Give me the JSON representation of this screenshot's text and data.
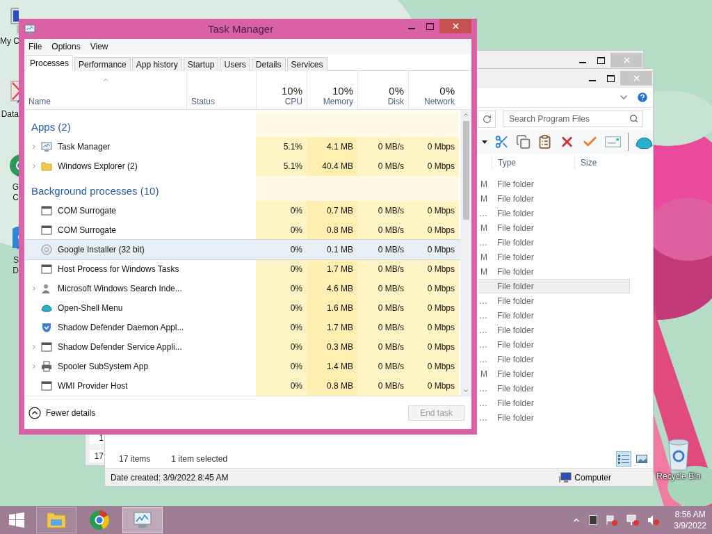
{
  "desktop_icons": [
    {
      "kind": "computer",
      "label": [
        "My C"
      ]
    },
    {
      "kind": "crossed",
      "label": [
        "Data"
      ]
    },
    {
      "kind": "round",
      "label": [
        "G",
        "C"
      ]
    },
    {
      "kind": "blue",
      "label": [
        "S",
        "D"
      ]
    }
  ],
  "recycle_bin": {
    "label": "Recycle Bin"
  },
  "back_window": {
    "fragments": [
      "1",
      "17"
    ]
  },
  "explorer": {
    "search": {
      "placeholder": "Search Program Files"
    },
    "columns": [
      "Type",
      "Size"
    ],
    "rows": [
      {
        "date": "M",
        "type": "File folder",
        "selected": false
      },
      {
        "date": "M",
        "type": "File folder",
        "selected": false
      },
      {
        "date": "…",
        "type": "File folder",
        "selected": false
      },
      {
        "date": "M",
        "type": "File folder",
        "selected": false
      },
      {
        "date": "…",
        "type": "File folder",
        "selected": false
      },
      {
        "date": "M",
        "type": "File folder",
        "selected": false
      },
      {
        "date": "M",
        "type": "File folder",
        "selected": false
      },
      {
        "date": "",
        "type": "File folder",
        "selected": true
      },
      {
        "date": "…",
        "type": "File folder",
        "selected": false
      },
      {
        "date": "…",
        "type": "File folder",
        "selected": false
      },
      {
        "date": "…",
        "type": "File folder",
        "selected": false
      },
      {
        "date": "…",
        "type": "File folder",
        "selected": false
      },
      {
        "date": "…",
        "type": "File folder",
        "selected": false
      },
      {
        "date": "M",
        "type": "File folder",
        "selected": false
      },
      {
        "date": "…",
        "type": "File folder",
        "selected": false
      },
      {
        "date": "…",
        "type": "File folder",
        "selected": false
      },
      {
        "date": "…",
        "type": "File folder",
        "selected": false
      }
    ],
    "status": {
      "count": "17 items",
      "selection": "1 item selected"
    },
    "views": [
      {
        "kind": "details",
        "selected": true
      },
      {
        "kind": "thumbnails",
        "selected": false
      }
    ],
    "details": "Date created: 3/9/2022 8:45 AM",
    "location": "Computer"
  },
  "task_manager": {
    "title": "Task Manager",
    "menu": [
      "File",
      "Options",
      "View"
    ],
    "tabs": [
      {
        "label": "Processes",
        "selected": true
      },
      {
        "label": "Performance",
        "selected": false
      },
      {
        "label": "App history",
        "selected": false
      },
      {
        "label": "Startup",
        "selected": false
      },
      {
        "label": "Users",
        "selected": false
      },
      {
        "label": "Details",
        "selected": false
      },
      {
        "label": "Services",
        "selected": false
      }
    ],
    "columns": [
      {
        "label": "Name",
        "sorted": true
      },
      {
        "label": "Status"
      },
      {
        "usage": "10%",
        "label": "CPU"
      },
      {
        "usage": "10%",
        "label": "Memory"
      },
      {
        "usage": "0%",
        "label": "Disk"
      },
      {
        "usage": "0%",
        "label": "Network"
      }
    ],
    "groups": [
      {
        "title": "Apps (2)",
        "processes": [
          {
            "name": "Task Manager",
            "kind": "monitor",
            "expandable": true,
            "selected": false,
            "cpu": "5.1%",
            "memory": "4.1 MB",
            "disk": "0 MB/s",
            "network": "0 Mbps"
          },
          {
            "name": "Windows Explorer (2)",
            "kind": "folder",
            "expandable": true,
            "selected": false,
            "cpu": "5.1%",
            "memory": "40.4 MB",
            "disk": "0 MB/s",
            "network": "0 Mbps"
          }
        ]
      },
      {
        "title": "Background processes (10)",
        "processes": [
          {
            "name": "COM Surrogate",
            "kind": "window",
            "expandable": false,
            "selected": false,
            "cpu": "0%",
            "memory": "0.7 MB",
            "disk": "0 MB/s",
            "network": "0 Mbps"
          },
          {
            "name": "COM Surrogate",
            "kind": "window",
            "expandable": false,
            "selected": false,
            "cpu": "0%",
            "memory": "0.8 MB",
            "disk": "0 MB/s",
            "network": "0 Mbps"
          },
          {
            "name": "Google Installer (32 bit)",
            "kind": "disc",
            "expandable": false,
            "selected": true,
            "cpu": "0%",
            "memory": "0.1 MB",
            "disk": "0 MB/s",
            "network": "0 Mbps"
          },
          {
            "name": "Host Process for Windows Tasks",
            "kind": "window",
            "expandable": false,
            "selected": false,
            "cpu": "0%",
            "memory": "1.7 MB",
            "disk": "0 MB/s",
            "network": "0 Mbps"
          },
          {
            "name": "Microsoft Windows Search Inde...",
            "kind": "person",
            "expandable": true,
            "selected": false,
            "cpu": "0%",
            "memory": "4.6 MB",
            "disk": "0 MB/s",
            "network": "0 Mbps"
          },
          {
            "name": "Open-Shell Menu",
            "kind": "shell",
            "expandable": false,
            "selected": false,
            "cpu": "0%",
            "memory": "1.6 MB",
            "disk": "0 MB/s",
            "network": "0 Mbps"
          },
          {
            "name": "Shadow Defender Daemon Appl...",
            "kind": "shield",
            "expandable": false,
            "selected": false,
            "cpu": "0%",
            "memory": "1.7 MB",
            "disk": "0 MB/s",
            "network": "0 Mbps"
          },
          {
            "name": "Shadow Defender Service Appli...",
            "kind": "window",
            "expandable": true,
            "selected": false,
            "cpu": "0%",
            "memory": "0.3 MB",
            "disk": "0 MB/s",
            "network": "0 Mbps"
          },
          {
            "name": "Spooler SubSystem App",
            "kind": "printer",
            "expandable": true,
            "selected": false,
            "cpu": "0%",
            "memory": "1.4 MB",
            "disk": "0 MB/s",
            "network": "0 Mbps"
          },
          {
            "name": "WMI Provider Host",
            "kind": "window",
            "expandable": false,
            "selected": false,
            "cpu": "0%",
            "memory": "0.8 MB",
            "disk": "0 MB/s",
            "network": "0 Mbps"
          }
        ]
      }
    ],
    "footer": {
      "toggle": "Fewer details",
      "end_task": {
        "label": "End task",
        "disabled": true
      }
    }
  },
  "taskbar": {
    "apps": [
      {
        "kind": "explorer",
        "running": true,
        "active": false
      },
      {
        "kind": "round",
        "running": false,
        "active": false
      },
      {
        "kind": "monitor",
        "running": true,
        "active": true
      }
    ],
    "clock": {
      "time": "8:56 AM",
      "date": "3/9/2022"
    }
  }
}
